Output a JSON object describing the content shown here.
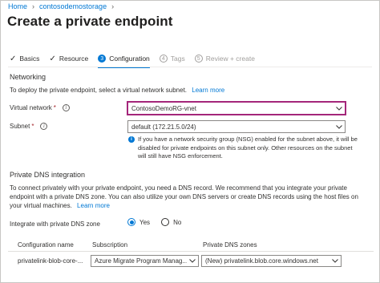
{
  "breadcrumb": {
    "home": "Home",
    "resource": "contosodemostorage"
  },
  "page": {
    "title": "Create a private endpoint"
  },
  "tabs": [
    {
      "label": "Basics",
      "state": "completed",
      "marker": "✓"
    },
    {
      "label": "Resource",
      "state": "completed",
      "marker": "✓"
    },
    {
      "label": "Configuration",
      "state": "active",
      "marker": "3"
    },
    {
      "label": "Tags",
      "state": "disabled",
      "marker": "4"
    },
    {
      "label": "Review + create",
      "state": "disabled",
      "marker": "5"
    }
  ],
  "networking": {
    "title": "Networking",
    "description": "To deploy the private endpoint, select a virtual network subnet.",
    "learn_more": "Learn more",
    "virtual_network": {
      "label": "Virtual network",
      "required": "*",
      "value": "ContosoDemoRG-vnet"
    },
    "subnet": {
      "label": "Subnet",
      "required": "*",
      "value": "default (172.21.5.0/24)"
    },
    "nsg_note": "If you have a network security group (NSG) enabled for the subnet above, it will be disabled for private endpoints on this subnet only. Other resources on the subnet will still have NSG enforcement."
  },
  "dns": {
    "title": "Private DNS integration",
    "description": "To connect privately with your private endpoint, you need a DNS record. We recommend that you integrate your private endpoint with a private DNS zone. You can also utilize your own DNS servers or create DNS records using the host files on your virtual machines.",
    "learn_more": "Learn more",
    "integrate_label": "Integrate with private DNS zone",
    "options": [
      {
        "label": "Yes",
        "checked": true
      },
      {
        "label": "No",
        "checked": false
      }
    ],
    "table": {
      "headers": [
        "Configuration name",
        "Subscription",
        "Private DNS zones"
      ],
      "rows": [
        {
          "configuration_name": "privatelink-blob-core-...",
          "subscription": "Azure Migrate Program Manag...",
          "private_dns_zone": "(New) privatelink.blob.core.windows.net"
        }
      ]
    }
  },
  "colors": {
    "accent": "#0078d4",
    "focus_border": "#a4267a",
    "required": "#a4262c"
  }
}
